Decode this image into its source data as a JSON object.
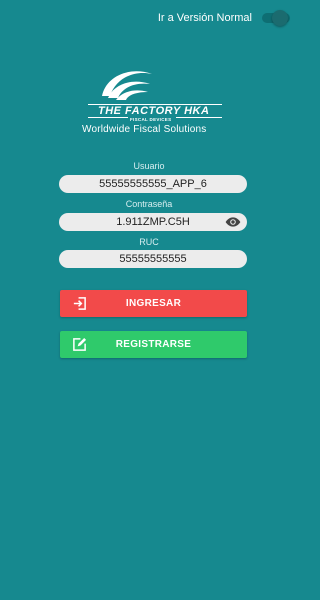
{
  "header": {
    "toggle_label": "Ir a Versión Normal",
    "toggle_on": true
  },
  "logo": {
    "brand": "THE FACTORY HKA",
    "sub": "FISCAL DEVICES",
    "tagline": "Worldwide Fiscal Solutions"
  },
  "form": {
    "usuario_label": "Usuario",
    "usuario_value": "55555555555_APP_6",
    "password_label": "Contraseña",
    "password_value": "1.911ZMP.C5H",
    "ruc_label": "RUC",
    "ruc_value": "55555555555"
  },
  "buttons": {
    "login_label": "INGRESAR",
    "register_label": "REGISTRARSE"
  },
  "colors": {
    "background": "#16898f",
    "login": "#f24a4a",
    "register": "#2fca6b",
    "field": "#ececec"
  },
  "icons": {
    "eye": "eye-icon",
    "login": "login-arrow-icon",
    "register": "edit-pencil-icon"
  }
}
